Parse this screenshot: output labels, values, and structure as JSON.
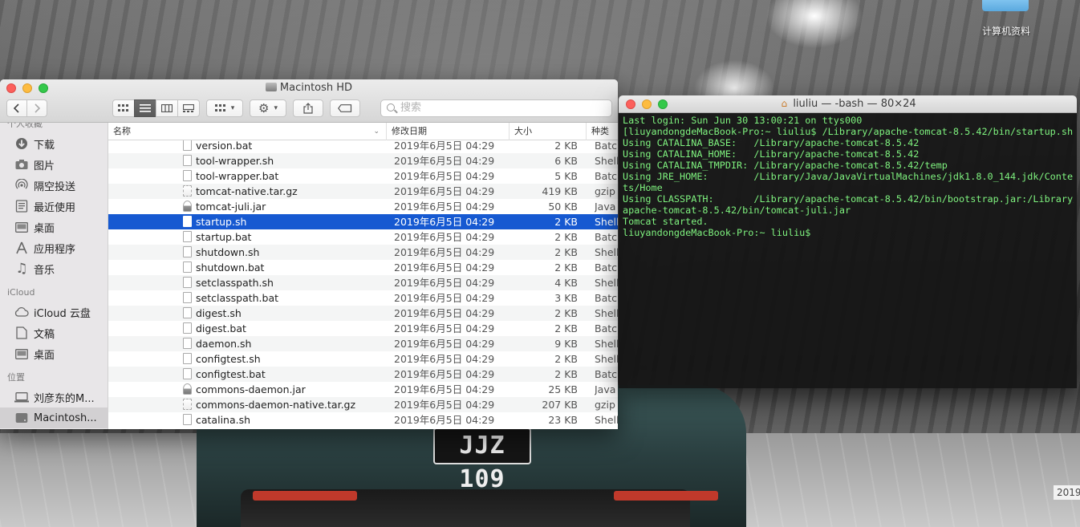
{
  "desktop": {
    "folder_label": "计算机资料",
    "plate_text": "JJZ 109",
    "corner_label": "2019"
  },
  "finder": {
    "title": "Macintosh HD",
    "search_placeholder": "搜索",
    "sidebar": {
      "sections": [
        {
          "title": "个人收藏",
          "items": [
            {
              "label": "下载",
              "icon": "download-icon"
            },
            {
              "label": "图片",
              "icon": "camera-icon"
            },
            {
              "label": "隔空投送",
              "icon": "airdrop-icon"
            },
            {
              "label": "最近使用",
              "icon": "recents-icon"
            },
            {
              "label": "桌面",
              "icon": "desktop-icon"
            },
            {
              "label": "应用程序",
              "icon": "applications-icon"
            },
            {
              "label": "音乐",
              "icon": "music-icon"
            }
          ]
        },
        {
          "title": "iCloud",
          "items": [
            {
              "label": "iCloud 云盘",
              "icon": "cloud-icon"
            },
            {
              "label": "文稿",
              "icon": "document-icon"
            },
            {
              "label": "桌面",
              "icon": "desktop-icon"
            }
          ]
        },
        {
          "title": "位置",
          "items": [
            {
              "label": "刘彦东的M...",
              "icon": "computer-icon"
            },
            {
              "label": "Macintosh...",
              "icon": "disk-icon",
              "selected": true
            }
          ]
        }
      ]
    },
    "columns": {
      "name": "名称",
      "date": "修改日期",
      "size": "大小",
      "kind": "种类"
    },
    "files": [
      {
        "name": "version.bat",
        "date": "2019年6月5日 04:29",
        "size": "2 KB",
        "kind": "Batch",
        "type": "doc"
      },
      {
        "name": "tool-wrapper.sh",
        "date": "2019年6月5日 04:29",
        "size": "6 KB",
        "kind": "Shell",
        "type": "doc"
      },
      {
        "name": "tool-wrapper.bat",
        "date": "2019年6月5日 04:29",
        "size": "5 KB",
        "kind": "Batch",
        "type": "doc"
      },
      {
        "name": "tomcat-native.tar.gz",
        "date": "2019年6月5日 04:29",
        "size": "419 KB",
        "kind": "gzip",
        "type": "gz"
      },
      {
        "name": "tomcat-juli.jar",
        "date": "2019年6月5日 04:29",
        "size": "50 KB",
        "kind": "Java",
        "type": "jar"
      },
      {
        "name": "startup.sh",
        "date": "2019年6月5日 04:29",
        "size": "2 KB",
        "kind": "Shell",
        "type": "doc",
        "selected": true
      },
      {
        "name": "startup.bat",
        "date": "2019年6月5日 04:29",
        "size": "2 KB",
        "kind": "Batch",
        "type": "doc"
      },
      {
        "name": "shutdown.sh",
        "date": "2019年6月5日 04:29",
        "size": "2 KB",
        "kind": "Shell",
        "type": "doc"
      },
      {
        "name": "shutdown.bat",
        "date": "2019年6月5日 04:29",
        "size": "2 KB",
        "kind": "Batch",
        "type": "doc"
      },
      {
        "name": "setclasspath.sh",
        "date": "2019年6月5日 04:29",
        "size": "4 KB",
        "kind": "Shell",
        "type": "doc"
      },
      {
        "name": "setclasspath.bat",
        "date": "2019年6月5日 04:29",
        "size": "3 KB",
        "kind": "Batch",
        "type": "doc"
      },
      {
        "name": "digest.sh",
        "date": "2019年6月5日 04:29",
        "size": "2 KB",
        "kind": "Shell",
        "type": "doc"
      },
      {
        "name": "digest.bat",
        "date": "2019年6月5日 04:29",
        "size": "2 KB",
        "kind": "Batch",
        "type": "doc"
      },
      {
        "name": "daemon.sh",
        "date": "2019年6月5日 04:29",
        "size": "9 KB",
        "kind": "Shell",
        "type": "doc"
      },
      {
        "name": "configtest.sh",
        "date": "2019年6月5日 04:29",
        "size": "2 KB",
        "kind": "Shell",
        "type": "doc"
      },
      {
        "name": "configtest.bat",
        "date": "2019年6月5日 04:29",
        "size": "2 KB",
        "kind": "Batch",
        "type": "doc"
      },
      {
        "name": "commons-daemon.jar",
        "date": "2019年6月5日 04:29",
        "size": "25 KB",
        "kind": "Java",
        "type": "jar"
      },
      {
        "name": "commons-daemon-native.tar.gz",
        "date": "2019年6月5日 04:29",
        "size": "207 KB",
        "kind": "gzip",
        "type": "gz"
      },
      {
        "name": "catalina.sh",
        "date": "2019年6月5日 04:29",
        "size": "23 KB",
        "kind": "Shell",
        "type": "doc"
      }
    ]
  },
  "terminal": {
    "title": "liuliu — -bash — 80×24",
    "lines": [
      "Last login: Sun Jun 30 13:00:21 on ttys000",
      "[liuyandongdeMacBook-Pro:~ liuliu$ /Library/apache-tomcat-8.5.42/bin/startup.sh  ]",
      "Using CATALINA_BASE:   /Library/apache-tomcat-8.5.42",
      "Using CATALINA_HOME:   /Library/apache-tomcat-8.5.42",
      "Using CATALINA_TMPDIR: /Library/apache-tomcat-8.5.42/temp",
      "Using JRE_HOME:        /Library/Java/JavaVirtualMachines/jdk1.8.0_144.jdk/Conten",
      "ts/Home",
      "Using CLASSPATH:       /Library/apache-tomcat-8.5.42/bin/bootstrap.jar:/Library/",
      "apache-tomcat-8.5.42/bin/tomcat-juli.jar",
      "Tomcat started.",
      "liuyandongdeMacBook-Pro:~ liuliu$ "
    ]
  }
}
